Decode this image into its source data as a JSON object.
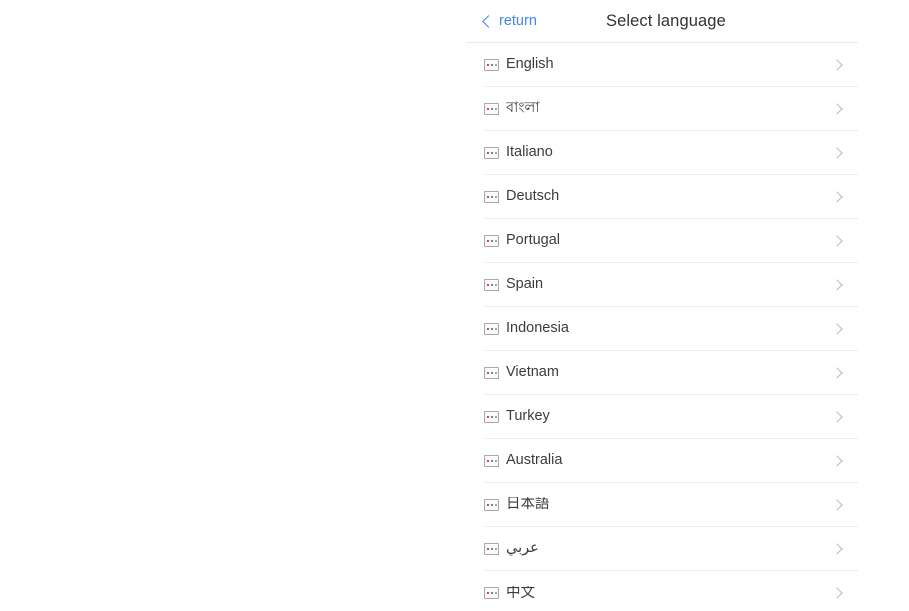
{
  "header": {
    "back_label": "return",
    "back_icon": "chevron-left-icon",
    "title": "Select language"
  },
  "list": {
    "row_icon": "broken-image-flag-icon",
    "row_chevron_icon": "chevron-right-icon",
    "items": [
      {
        "label": "English",
        "rtl": false
      },
      {
        "label": "বাংলা",
        "rtl": false
      },
      {
        "label": "Italiano",
        "rtl": false
      },
      {
        "label": "Deutsch",
        "rtl": false
      },
      {
        "label": "Portugal",
        "rtl": false
      },
      {
        "label": "Spain",
        "rtl": false
      },
      {
        "label": "Indonesia",
        "rtl": false
      },
      {
        "label": "Vietnam",
        "rtl": false
      },
      {
        "label": "Turkey",
        "rtl": false
      },
      {
        "label": "Australia",
        "rtl": false
      },
      {
        "label": "日本語",
        "rtl": false
      },
      {
        "label": "عربي",
        "rtl": true
      },
      {
        "label": "中文",
        "rtl": false
      }
    ]
  },
  "colors": {
    "link": "#4285f4",
    "title": "#333333",
    "label": "#3c3c3c",
    "divider": "#ededed",
    "chevron": "#b9b9b9",
    "background": "#ffffff"
  }
}
